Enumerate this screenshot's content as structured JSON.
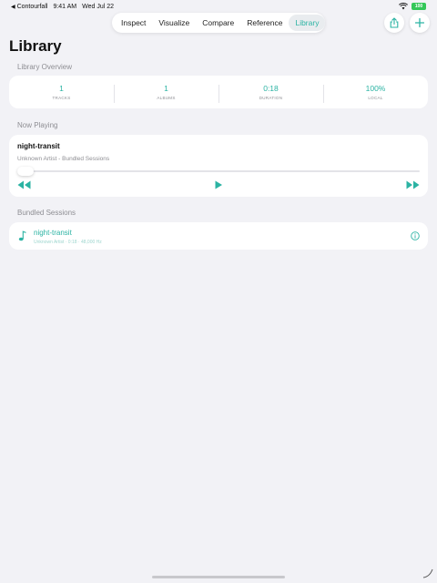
{
  "status": {
    "back_app": "Contourfall",
    "time": "9:41 AM",
    "date": "Wed Jul 22",
    "battery": "100"
  },
  "tabs": [
    {
      "label": "Inspect",
      "active": false
    },
    {
      "label": "Visualize",
      "active": false
    },
    {
      "label": "Compare",
      "active": false
    },
    {
      "label": "Reference",
      "active": false
    },
    {
      "label": "Library",
      "active": true
    }
  ],
  "page": {
    "title": "Library"
  },
  "overview": {
    "section_title": "Library Overview",
    "stats": [
      {
        "value": "1",
        "label": "TRACKS"
      },
      {
        "value": "1",
        "label": "ALBUMS"
      },
      {
        "value": "0:18",
        "label": "DURATION"
      },
      {
        "value": "100%",
        "label": "LOCAL"
      }
    ]
  },
  "now_playing": {
    "section_title": "Now Playing",
    "title": "night-transit",
    "subtitle": "Unknown Artist - Bundled Sessions",
    "progress": 0
  },
  "sessions": {
    "section_title": "Bundled Sessions",
    "items": [
      {
        "title": "night-transit",
        "meta": "Unknown Artist · 0:18 · 48,000 Hz"
      }
    ]
  },
  "colors": {
    "accent": "#2bb3a3",
    "background": "#f2f2f6",
    "card": "#ffffff",
    "secondary_text": "#8e8e93"
  },
  "icons": {
    "share": "share-icon",
    "add": "plus-icon",
    "rewind": "rewind-icon",
    "play": "play-icon",
    "forward": "fast-forward-icon",
    "note": "music-note-icon",
    "info": "info-icon"
  }
}
